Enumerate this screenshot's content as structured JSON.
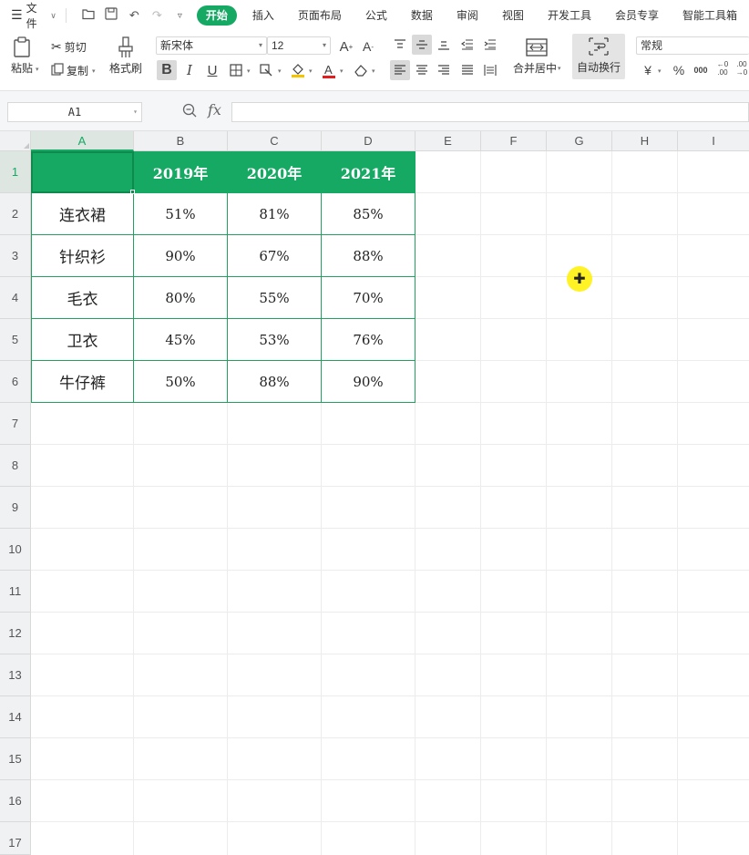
{
  "menubar": {
    "file_label": "文件",
    "quick_access": [
      "open-folder-icon",
      "save-icon",
      "undo-icon",
      "redo-icon",
      "more-icon"
    ],
    "tabs": [
      "开始",
      "插入",
      "页面布局",
      "公式",
      "数据",
      "审阅",
      "视图",
      "开发工具",
      "会员专享",
      "智能工具箱"
    ],
    "active_tab": "开始"
  },
  "ribbon": {
    "paste": "粘贴",
    "cut": "剪切",
    "copy": "复制",
    "format_painter": "格式刷",
    "font_name": "新宋体",
    "font_size": "12",
    "merge_center": "合并居中",
    "wrap_text": "自动换行",
    "number_format": "常规",
    "currency_symbol": "¥",
    "percent_symbol": "%",
    "thousands_symbol": "000",
    "dec_increase": "←0 .00",
    "dec_decrease": ".00 →0"
  },
  "formula_bar": {
    "name_box": "A1",
    "fx": "fx",
    "formula": ""
  },
  "sheet": {
    "columns": [
      "A",
      "B",
      "C",
      "D",
      "E",
      "F",
      "G",
      "H",
      "I"
    ],
    "rows": [
      "1",
      "2",
      "3",
      "4",
      "5",
      "6",
      "7",
      "8",
      "9",
      "10",
      "11",
      "12",
      "13",
      "14",
      "15",
      "16",
      "17"
    ],
    "selected_cell": "A1",
    "header_row": [
      "",
      "2019年",
      "2020年",
      "2021年"
    ],
    "data_rows": [
      [
        "连衣裙",
        "51%",
        "81%",
        "85%"
      ],
      [
        "针织衫",
        "90%",
        "67%",
        "88%"
      ],
      [
        "毛衣",
        "80%",
        "55%",
        "70%"
      ],
      [
        "卫衣",
        "45%",
        "53%",
        "76%"
      ],
      [
        "牛仔裤",
        "50%",
        "88%",
        "90%"
      ]
    ]
  },
  "colors": {
    "accent": "#16a963",
    "table_border": "#23a25f",
    "cursor_highlight": "#fff200"
  }
}
